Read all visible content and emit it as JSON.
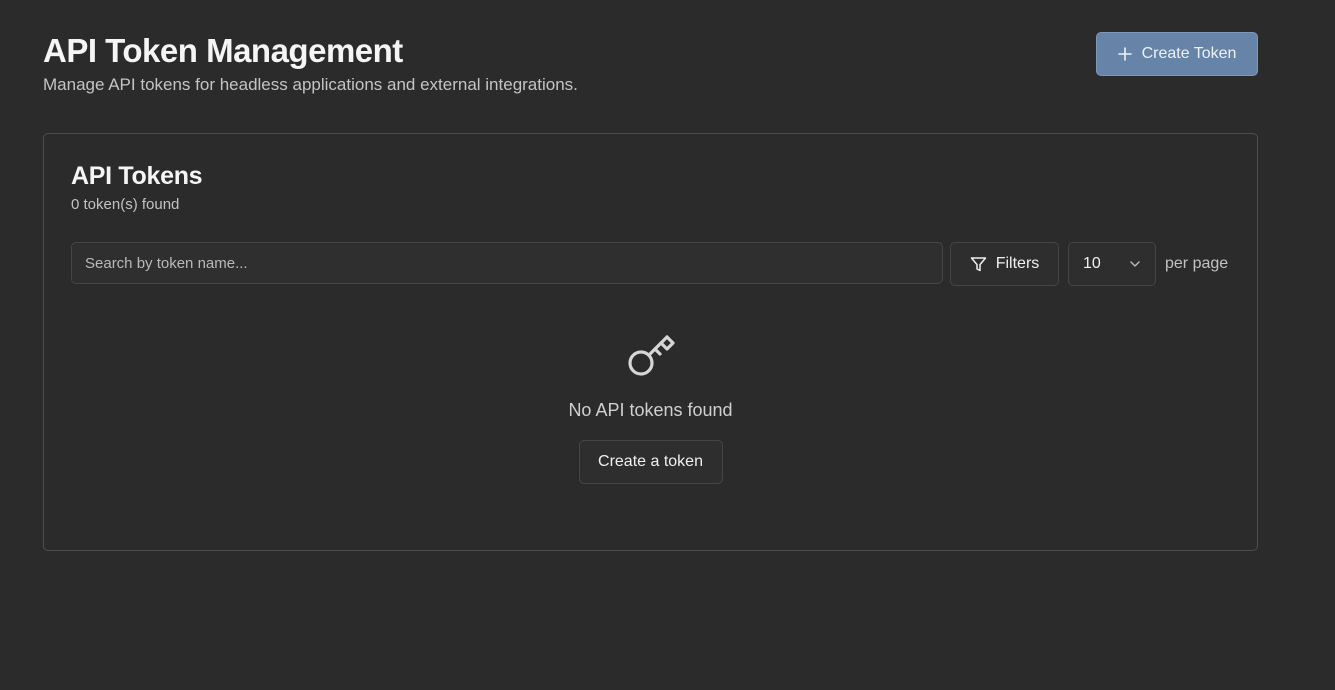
{
  "header": {
    "title": "API Token Management",
    "subtitle": "Manage API tokens for headless applications and external integrations.",
    "create_button_label": "Create Token",
    "create_button_icon": "plus-icon"
  },
  "tokens_card": {
    "title": "API Tokens",
    "count_text": "0 token(s) found",
    "search": {
      "placeholder": "Search by token name...",
      "value": ""
    },
    "filters_label": "Filters",
    "filters_icon": "filter-icon",
    "per_page": {
      "selected": "10",
      "suffix": "per page",
      "icon": "chevron-down-icon"
    },
    "empty_state": {
      "icon": "key-icon",
      "message": "No API tokens found",
      "action_label": "Create a token"
    }
  },
  "colors": {
    "background": "#2b2b2b",
    "primary_button": "#6683a8",
    "border": "#4d4d4d",
    "text_primary": "#f5f5f5",
    "text_secondary": "#c2c2c2"
  }
}
